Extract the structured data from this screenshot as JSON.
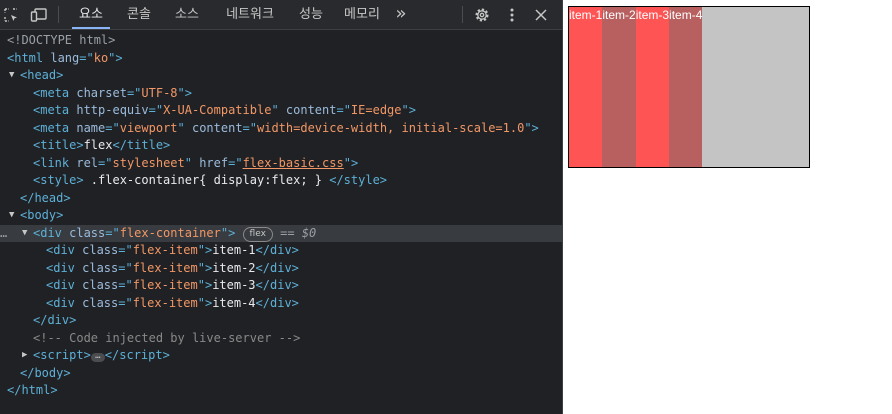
{
  "toolbar": {
    "tabs": [
      {
        "label": "요소"
      },
      {
        "label": "콘솔"
      },
      {
        "label": "소스"
      },
      {
        "label": "네트워크"
      },
      {
        "label": "성능"
      },
      {
        "label": "메모리"
      }
    ],
    "more_label": "»"
  },
  "dom": {
    "doctype": "<!DOCTYPE html>",
    "html_lang": "ko",
    "meta_charset": "UTF-8",
    "meta_http_equiv": "X-UA-Compatible",
    "meta_content_ie": "IE=edge",
    "meta_name": "viewport",
    "meta_viewport_content": "width=device-width, initial-scale=1.0",
    "title_text": "flex",
    "link_rel": "stylesheet",
    "link_href": "flex-basic.css",
    "style_text": " .flex-container{ display:flex; } ",
    "container_class": "flex-container",
    "badge": "flex",
    "dollar": "== $0",
    "item_class": "flex-item",
    "items": [
      "item-1",
      "item-2",
      "item-3",
      "item-4"
    ],
    "comment": "<!-- Code injected by live-server -->"
  },
  "preview": {
    "items": [
      {
        "label": "item-1",
        "color": "#ff5454"
      },
      {
        "label": "item-2",
        "color": "#b85f5f"
      },
      {
        "label": "item-3",
        "color": "#ff5454"
      },
      {
        "label": "item-4",
        "color": "#b85f5f"
      }
    ],
    "container_color": "#c4c4c4"
  }
}
